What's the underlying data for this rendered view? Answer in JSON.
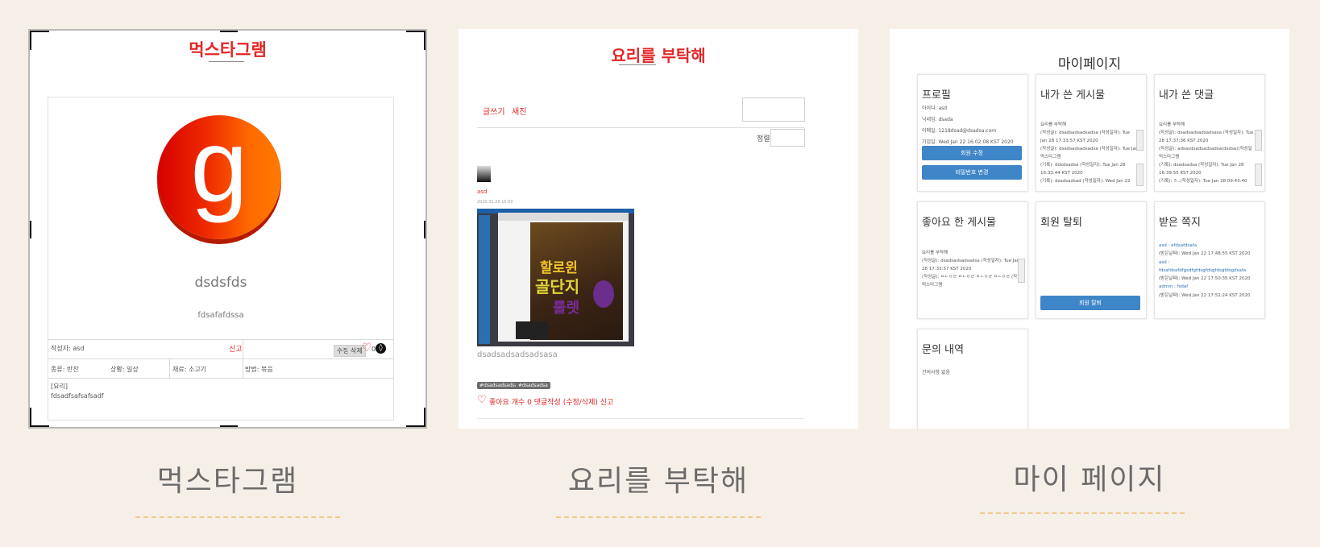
{
  "cards": [
    {
      "brand": "먹스타그램",
      "caption": "먹스타그램",
      "post": {
        "avatar_letter": "g",
        "username": "dsdsfds",
        "subtitle": "fdsafafdssa",
        "author": "작성자: asd",
        "report": "신고",
        "edit": "수정",
        "delete": "삭제",
        "like_count": "0",
        "cells": [
          "종류: 반찬",
          "상황: 일상",
          "재료: 소고기",
          "방법: 볶음"
        ],
        "recipe_label": "[요리]",
        "recipe_text": "fdsadfsafsafsadf"
      }
    },
    {
      "brand": "요리를 부탁해",
      "caption": "요리를 부탁해",
      "nav": [
        "글쓰기",
        "새진"
      ],
      "sort_label": "정렬",
      "author": "asd",
      "date": "2020.01.20 15:00",
      "screenshot_text_1": "할로윈",
      "screenshot_text_2": "골단지",
      "screenshot_text_3": "룰렛",
      "body": "dsadsadsadsadsasa",
      "tags": [
        "#dsadsadsadsasa",
        "#dsadsadsa"
      ],
      "actions": "좋아요 개수 0 댓글작성 (수정/삭제) 신고"
    },
    {
      "page_title": "마이페이지",
      "caption": "마이 페이지",
      "panels": {
        "profile": {
          "title": "프로필",
          "lines": [
            "아이디: asd",
            "닉네임: dsada",
            "이메일: 1218dsad@dsadsa.com",
            "가입일: Wed Jan 22 16:02:08 KST 2020"
          ],
          "btn1": "회원 수정",
          "btn2": "비밀번호 변경"
        },
        "my_posts": {
          "title": "내가 쓴 게시물",
          "lines": [
            "요리를 부탁해",
            "(작성글): dsadsadsadsadsa (작성일자): Tue",
            "Jan 28 17:33:57 KST 2020",
            "(작성글): dsadsadsadsadsa (작성일자): Tue Jan",
            "먹스타그램",
            "(기록): ddsdsadsa (작성일자): Tue Jan 28",
            "16:33:44 KST 2020",
            "(기록): dsadsadsad (작성일자): Wed Jan 22"
          ]
        },
        "my_comments": {
          "title": "내가 쓴 댓글",
          "lines": [
            "요리를 부탁해",
            "(작성글): dsadsadsadsadsasa (작성일자): Tue Jan",
            "28 17:37:36 KST 2020",
            "(작성글): adsasdsadsadsadsa(dsdsa)(작성일",
            "먹스타그램",
            "(기록): dsadsadsa (작성일자): Tue Jan 28",
            "16:39:55 KST 2020",
            "(기록): ㅎ..(작성일자): Tue Jan 28 09:43:40"
          ]
        },
        "liked": {
          "title": "좋아요 한 게시물",
          "lines": [
            "요리를 부탁해",
            "(작성글): dsadsadsadsadsa (작성일자): Tue Jan",
            "28 17:33:57 KST 2020",
            "(작성글): ㅁㄴㅇㄹ ㅁㄴㅇㄹ ㅁㄴㅇㄹ ㅁㄴㅇㄹ (작)",
            "먹스타그램"
          ]
        },
        "withdraw": {
          "title": "회원 탈퇴",
          "btn": "회원 탈퇴"
        },
        "messages": {
          "title": "받은 쪽지",
          "lines": [
            "asd : efdsafdsafa",
            "(받은날짜): Wed Jan 22 17:48:55 KST 2020",
            "asd :",
            "fdsafdsafdfgsdfgfdsgfdsgfdsgfdsgdsafa",
            "(받은날짜): Wed Jan 22 17:50:35 KST 2020",
            "admin : fsdaf",
            "(받은날짜): Wed Jan 22 17:51:24 KST 2020"
          ]
        },
        "inquiry": {
          "title": "문의 내역",
          "lines": [
            "건의사항 없음"
          ]
        }
      }
    }
  ],
  "colors": {
    "background": "#f6efe8",
    "accent_red": "#e32626",
    "dash": "#f1c889",
    "button_blue": "#3f86c9"
  }
}
